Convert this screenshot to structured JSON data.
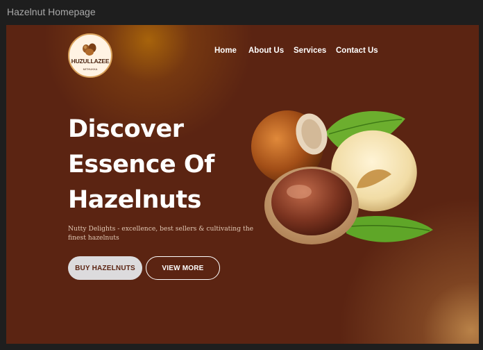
{
  "window": {
    "title": "Hazelnut Homepage"
  },
  "brand": {
    "logo_text": "HUZULLAZEE",
    "logo_sub": "MITHUKKA"
  },
  "nav": {
    "items": [
      {
        "label": "Home"
      },
      {
        "label": "About Us"
      },
      {
        "label": "Services"
      },
      {
        "label": "Contact Us"
      }
    ]
  },
  "hero": {
    "title_lines": [
      "Discover",
      "Essence Of",
      "Hazelnuts"
    ],
    "tagline": "Nutty Delights - excellence, best sellers & cultivating the finest hazelnuts",
    "primary_button": "BUY HAZELNUTS",
    "secondary_button": "VIEW MORE"
  },
  "colors": {
    "background": "#5b2412",
    "accent_glow": "#b46e0a",
    "button_light": "#dcdbdd",
    "text": "#ffffff"
  }
}
